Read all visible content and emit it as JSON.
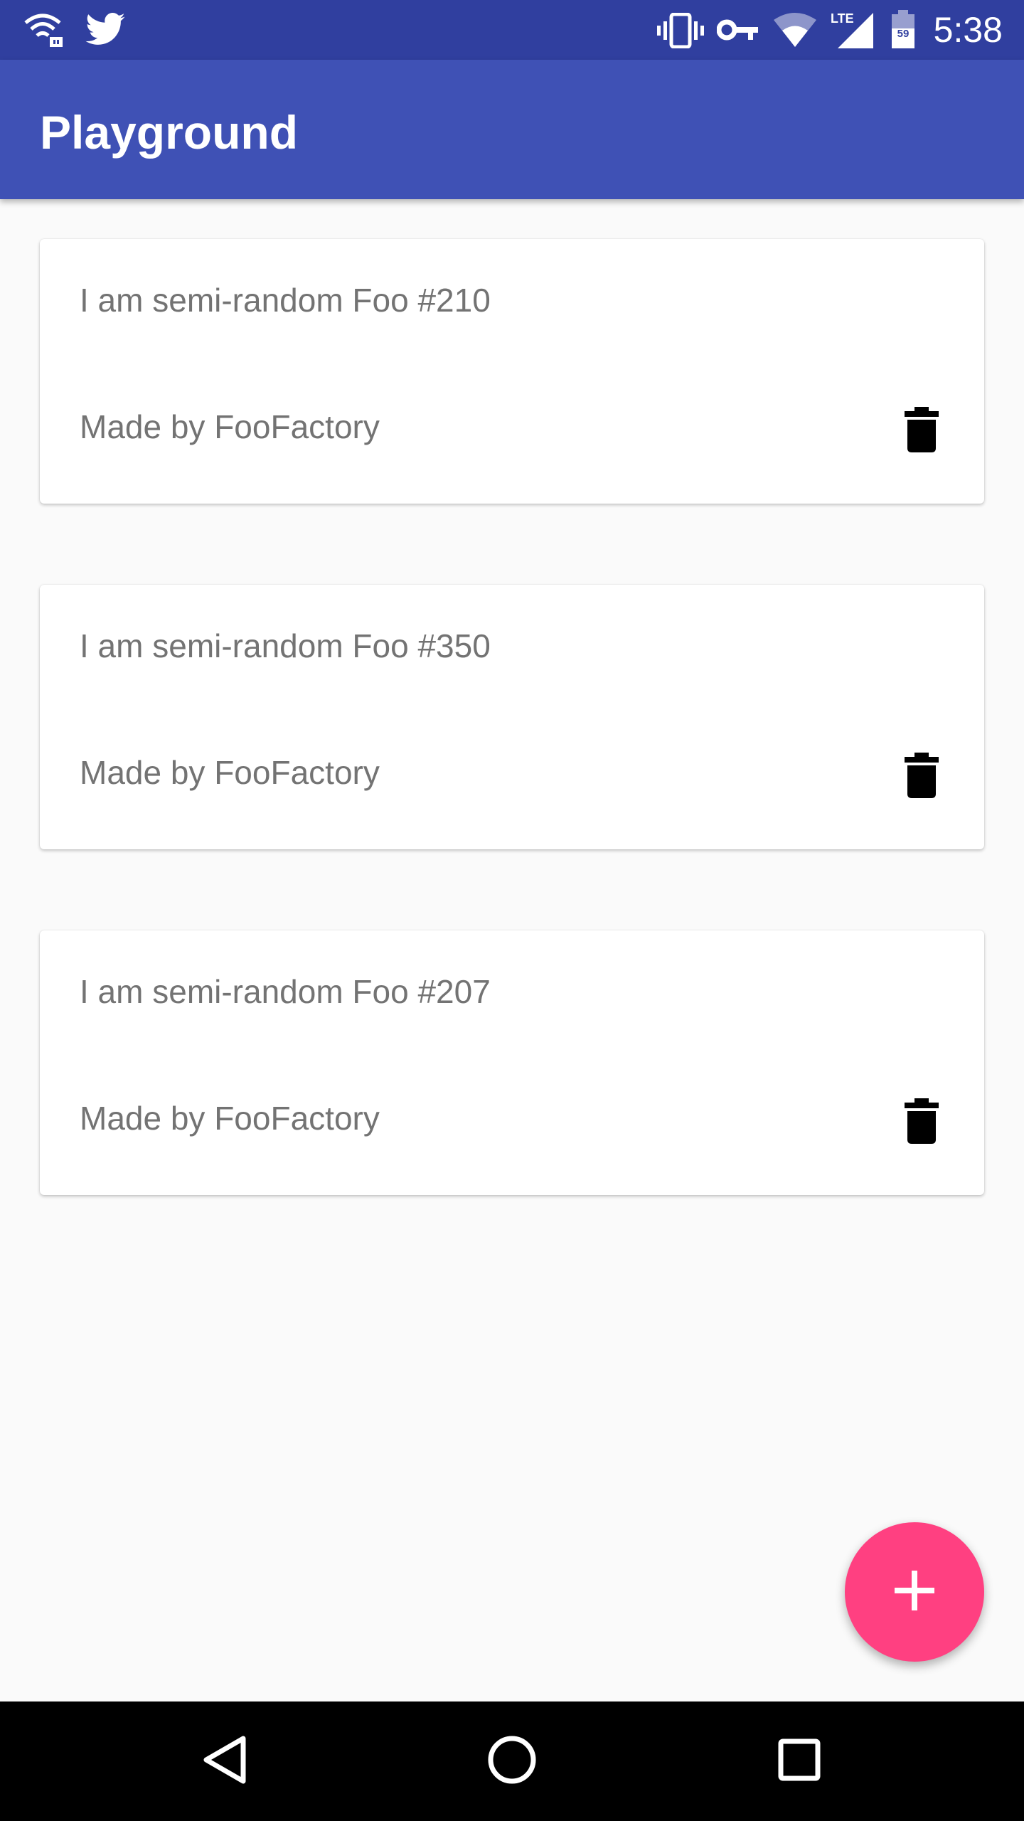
{
  "status_bar": {
    "time": "5:38",
    "battery_level": "59",
    "network_type": "LTE",
    "icons": [
      "wifi-lock-icon",
      "twitter-icon",
      "vibrate-icon",
      "vpn-key-icon",
      "wifi-icon",
      "signal-icon",
      "battery-icon"
    ]
  },
  "app_bar": {
    "title": "Playground"
  },
  "cards": [
    {
      "title": "I am semi-random Foo #210",
      "subtitle": "Made by FooFactory",
      "action_icon": "delete-icon"
    },
    {
      "title": "I am semi-random Foo #350",
      "subtitle": "Made by FooFactory",
      "action_icon": "delete-icon"
    },
    {
      "title": "I am semi-random Foo #207",
      "subtitle": "Made by FooFactory",
      "action_icon": "delete-icon"
    }
  ],
  "fab": {
    "icon": "add-icon"
  },
  "nav_bar": {
    "icons": [
      "back-icon",
      "home-icon",
      "recents-icon"
    ]
  },
  "colors": {
    "status_bar": "#303f9f",
    "app_bar": "#3f51b5",
    "accent": "#ff4081",
    "background": "#fafafa",
    "card_text": "#737373"
  }
}
